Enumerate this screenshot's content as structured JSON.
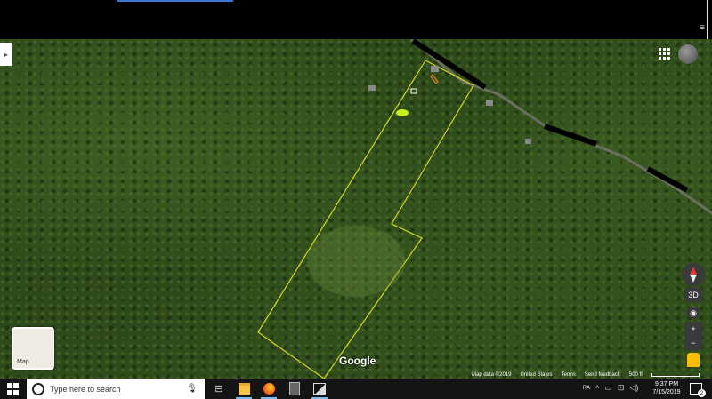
{
  "map": {
    "logo": "Google",
    "layer_toggle_label": "Map",
    "controls": {
      "tilt_label": "3D",
      "zoom_in_label": "+",
      "zoom_out_label": "−"
    },
    "attribution": {
      "map_data": "Map data ©2019",
      "region": "United States",
      "terms": "Terms",
      "feedback": "Send feedback",
      "scale": "500 ft"
    },
    "icons": [
      "apps-icon",
      "compass-icon",
      "pegman-icon",
      "location-icon"
    ]
  },
  "taskbar": {
    "search_placeholder": "Type here to search",
    "pinned": [
      "task-view-icon",
      "file-explorer-icon",
      "firefox-icon",
      "calculator-icon",
      "photos-icon"
    ],
    "clock_time": "9:37 PM",
    "clock_date": "7/15/2019",
    "notification_count": "2"
  }
}
